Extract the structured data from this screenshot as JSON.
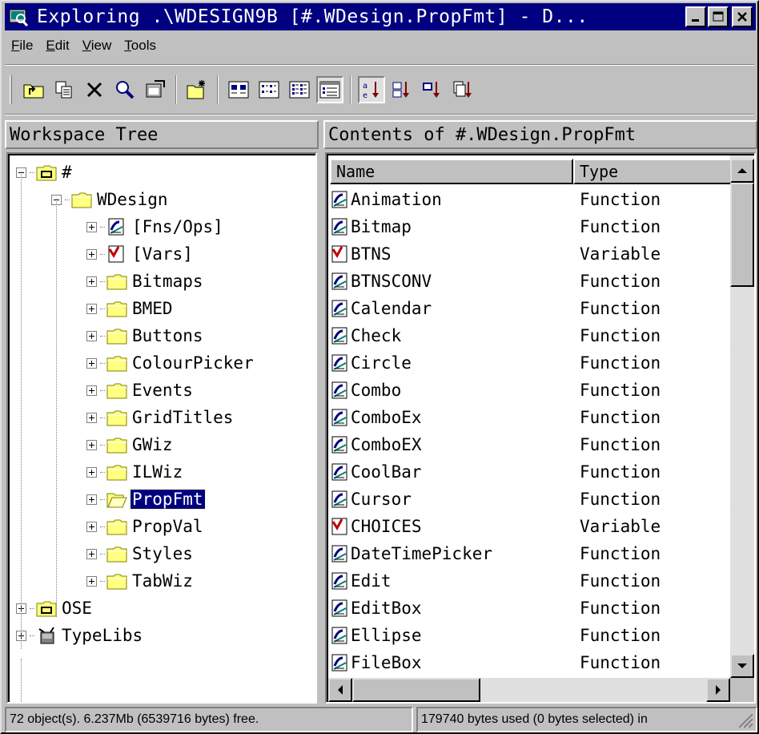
{
  "window": {
    "title": "Exploring .\\WDESIGN9B [#.WDesign.PropFmt] - D..."
  },
  "menu": [
    {
      "label": "File",
      "key": "F",
      "rest": "ile"
    },
    {
      "label": "Edit",
      "key": "E",
      "rest": "dit"
    },
    {
      "label": "View",
      "key": "V",
      "rest": "iew"
    },
    {
      "label": "Tools",
      "key": "T",
      "rest": "ools"
    }
  ],
  "toolbar": {
    "icons": [
      "up-folder-icon",
      "copy-icon",
      "delete-icon",
      "find-icon",
      "properties-icon",
      "new-object-icon",
      "large-icons-view-icon",
      "small-icons-view-icon",
      "list-view-icon",
      "details-view-icon",
      "sort-by-name-icon",
      "sort-by-type-icon",
      "sort-by-size-icon",
      "sort-by-date-icon"
    ]
  },
  "tree_header": "Workspace Tree",
  "list_header": "Contents of #.WDesign.PropFmt",
  "tree": [
    {
      "label": "#",
      "level": 0,
      "icon": "workspace-icon",
      "expander": "minus"
    },
    {
      "label": "WDesign",
      "level": 1,
      "icon": "folder-icon",
      "expander": "minus"
    },
    {
      "label": "[Fns/Ops]",
      "level": 2,
      "icon": "function-icon",
      "expander": "plus"
    },
    {
      "label": "[Vars]",
      "level": 2,
      "icon": "variable-icon",
      "expander": "plus"
    },
    {
      "label": "Bitmaps",
      "level": 2,
      "icon": "folder-icon",
      "expander": "plus"
    },
    {
      "label": "BMED",
      "level": 2,
      "icon": "folder-icon",
      "expander": "plus"
    },
    {
      "label": "Buttons",
      "level": 2,
      "icon": "folder-icon",
      "expander": "plus"
    },
    {
      "label": "ColourPicker",
      "level": 2,
      "icon": "folder-icon",
      "expander": "plus"
    },
    {
      "label": "Events",
      "level": 2,
      "icon": "folder-icon",
      "expander": "plus"
    },
    {
      "label": "GridTitles",
      "level": 2,
      "icon": "folder-icon",
      "expander": "plus"
    },
    {
      "label": "GWiz",
      "level": 2,
      "icon": "folder-icon",
      "expander": "plus"
    },
    {
      "label": "ILWiz",
      "level": 2,
      "icon": "folder-icon",
      "expander": "plus"
    },
    {
      "label": "PropFmt",
      "level": 2,
      "icon": "open-folder-icon",
      "expander": "plus",
      "selected": true
    },
    {
      "label": "PropVal",
      "level": 2,
      "icon": "folder-icon",
      "expander": "plus"
    },
    {
      "label": "Styles",
      "level": 2,
      "icon": "folder-icon",
      "expander": "plus"
    },
    {
      "label": "TabWiz",
      "level": 2,
      "icon": "folder-icon",
      "expander": "plus"
    },
    {
      "label": "OSE",
      "level": 0,
      "icon": "workspace-icon",
      "expander": "plus"
    },
    {
      "label": "TypeLibs",
      "level": 0,
      "icon": "typelib-icon",
      "expander": "plus"
    }
  ],
  "columns": {
    "name": "Name",
    "type": "Type"
  },
  "items": [
    {
      "name": "Animation",
      "type": "Function"
    },
    {
      "name": "Bitmap",
      "type": "Function"
    },
    {
      "name": "BTNS",
      "type": "Variable"
    },
    {
      "name": "BTNSCONV",
      "type": "Function"
    },
    {
      "name": "Calendar",
      "type": "Function"
    },
    {
      "name": "Check",
      "type": "Function"
    },
    {
      "name": "Circle",
      "type": "Function"
    },
    {
      "name": "Combo",
      "type": "Function"
    },
    {
      "name": "ComboEx",
      "type": "Function"
    },
    {
      "name": "ComboEX",
      "type": "Function"
    },
    {
      "name": "CoolBar",
      "type": "Function"
    },
    {
      "name": "Cursor",
      "type": "Function"
    },
    {
      "name": "CHOICES",
      "type": "Variable"
    },
    {
      "name": "DateTimePicker",
      "type": "Function"
    },
    {
      "name": "Edit",
      "type": "Function"
    },
    {
      "name": "EditBox",
      "type": "Function"
    },
    {
      "name": "Ellipse",
      "type": "Function"
    },
    {
      "name": "FileBox",
      "type": "Function"
    }
  ],
  "status": {
    "left": "72 object(s). 6.237Mb (6539716 bytes) free.",
    "right": "179740 bytes used (0 bytes selected)  in"
  }
}
